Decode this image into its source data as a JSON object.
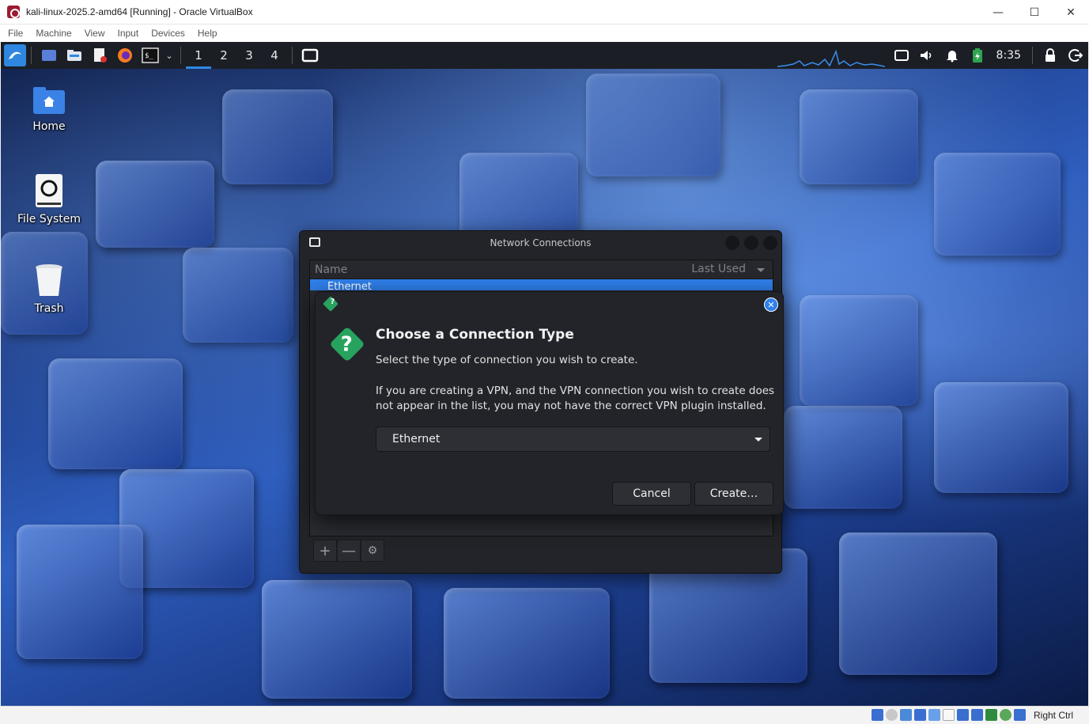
{
  "vbox": {
    "title": "kali-linux-2025.2-amd64 [Running] - Oracle VirtualBox",
    "menu": [
      "File",
      "Machine",
      "View",
      "Input",
      "Devices",
      "Help"
    ],
    "win_minimize": "—",
    "win_maximize": "☐",
    "win_close": "✕",
    "host_key": "Right Ctrl",
    "status_icons": [
      "hard-disk-icon",
      "optical-drive-icon",
      "audio-icon",
      "network-icon",
      "usb-icon",
      "shared-folders-icon",
      "display-icon",
      "video-capture-icon",
      "guest-additions-icon",
      "cpu-icon",
      "mouse-integration-icon",
      "keyboard-icon"
    ]
  },
  "panel": {
    "workspaces": [
      "1",
      "2",
      "3",
      "4"
    ],
    "active_workspace": "1",
    "clock": "8:35"
  },
  "desktop": {
    "icons": [
      {
        "label": "Home",
        "icon": "home-folder-icon"
      },
      {
        "label": "File System",
        "icon": "drive-icon"
      },
      {
        "label": "Trash",
        "icon": "trash-icon"
      }
    ]
  },
  "network_connections": {
    "title": "Network Connections",
    "columns": [
      "Name",
      "Last Used"
    ],
    "rows": [
      {
        "label": "Ethernet",
        "expanded": true,
        "selected": true
      }
    ],
    "toolbar": {
      "add": "+",
      "remove": "—",
      "settings": "⚙"
    }
  },
  "dialog": {
    "heading": "Choose a Connection Type",
    "subtitle": "Select the type of connection you wish to create.",
    "body": "If you are creating a VPN, and the VPN connection you wish to create does not appear in the list, you may not have the correct VPN plugin installed.",
    "combo_value": "Ethernet",
    "cancel_label": "Cancel",
    "create_label": "Create…",
    "close_glyph": "✕",
    "question_glyph": "?"
  },
  "colors": {
    "accent": "#2f80ec",
    "panel_bg": "#1b1e25",
    "window_bg": "#222429",
    "question_green": "#27a35f"
  }
}
